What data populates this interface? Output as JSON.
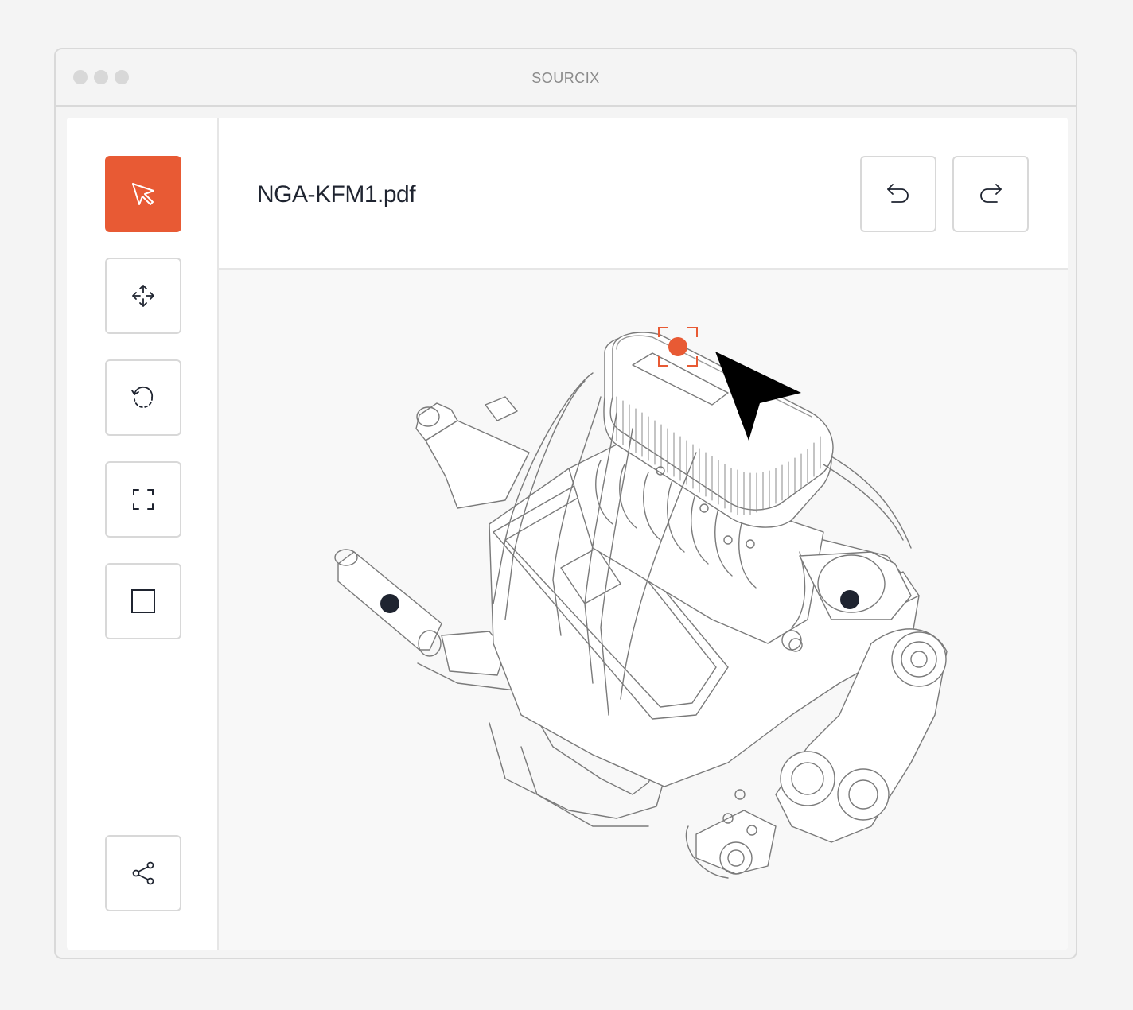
{
  "window": {
    "title": "SOURCIX"
  },
  "toolbar": {
    "tools": [
      {
        "id": "select",
        "icon": "cursor-icon",
        "active": true
      },
      {
        "id": "move",
        "icon": "move-arrows-icon",
        "active": false
      },
      {
        "id": "rotate",
        "icon": "rotate-icon",
        "active": false
      },
      {
        "id": "fit",
        "icon": "frame-corners-icon",
        "active": false
      },
      {
        "id": "box",
        "icon": "square-icon",
        "active": false
      }
    ],
    "share": {
      "icon": "share-icon"
    }
  },
  "header": {
    "file_name": "NGA-KFM1.pdf",
    "undo": {
      "icon": "undo-icon"
    },
    "redo": {
      "icon": "redo-icon"
    }
  },
  "viewer": {
    "model": "engine-line-drawing",
    "hotspots": [
      {
        "id": "hotspot-air-filter",
        "state": "selected",
        "color": "#e85a34"
      },
      {
        "id": "hotspot-exhaust",
        "state": "normal",
        "color": "#1f2430"
      },
      {
        "id": "hotspot-supercharger",
        "state": "normal",
        "color": "#1f2430"
      }
    ]
  },
  "colors": {
    "accent": "#e85a34",
    "ink": "#1f2430",
    "border": "#d8d8d8"
  }
}
